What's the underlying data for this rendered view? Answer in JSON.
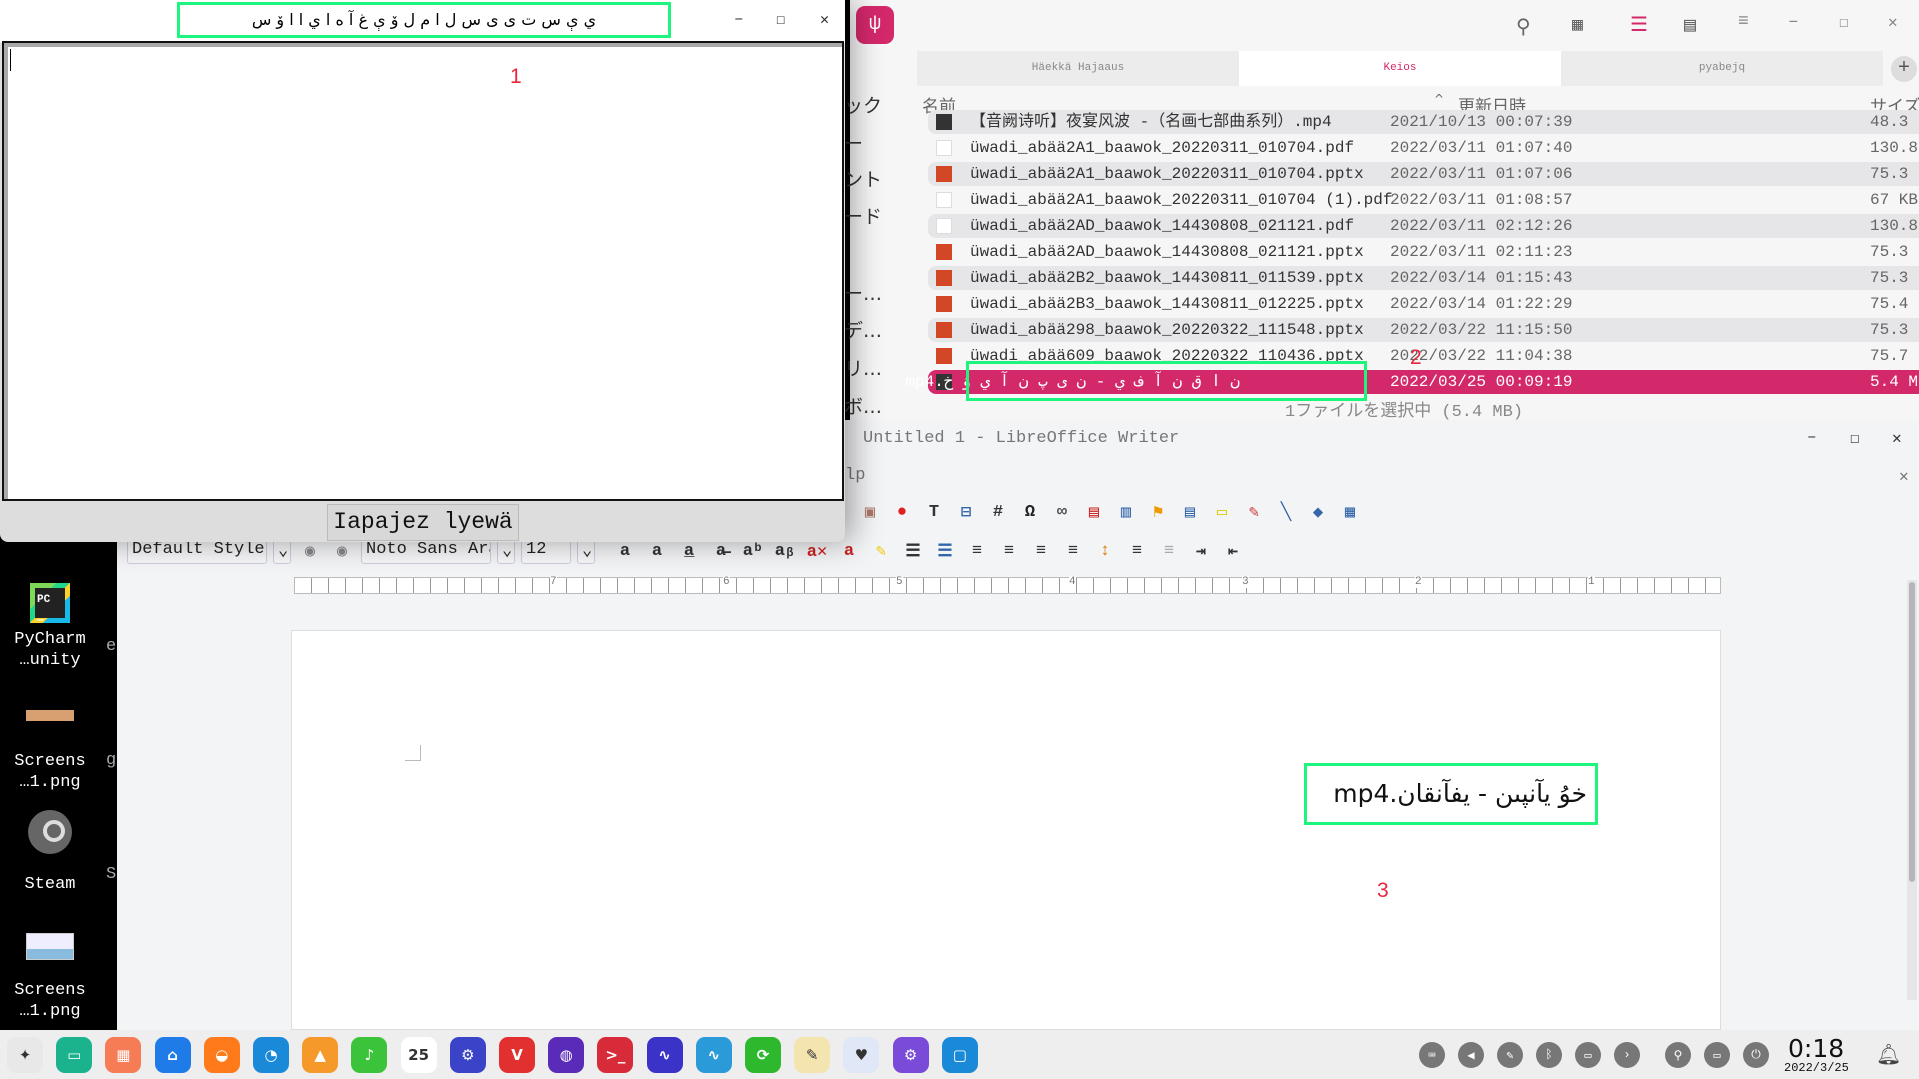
{
  "desktop": {
    "icons": [
      {
        "label1": "PyCharm",
        "label2": "…unity"
      },
      {
        "label1": "Screens",
        "label2": "…1.png"
      },
      {
        "label1": "Steam",
        "label2": ""
      },
      {
        "label1": "Screens",
        "label2": "…1.png"
      }
    ],
    "behind_fragments": [
      "e",
      "g",
      "S"
    ]
  },
  "dialog": {
    "title": "ي ې س ت ى  ى س ل ا م  ل ۆ ې غ آ  ه ا ي ا ا ۆ س",
    "button": "Iapajez lyewä",
    "marker": "1"
  },
  "file_manager": {
    "tabs": [
      "Häekkä Hajaaus",
      "Keios",
      "pyabejq"
    ],
    "columns": {
      "name": "名前",
      "date": "更新日時",
      "size": "サイズ"
    },
    "sidebar": [
      "ック",
      "ー",
      "ント",
      "ード",
      "ー…",
      "デ…",
      "リ…",
      "ボ…"
    ],
    "rows": [
      {
        "name": "【音阙诗听】夜宴风波 -（名画七部曲系列）.mp4",
        "date": "2021/10/13 00:07:39",
        "size": "48.3",
        "type": "video"
      },
      {
        "name": "üwadi_abää2A1_baawok_20220311_010704.pdf",
        "date": "2022/03/11 01:07:40",
        "size": "130.8",
        "type": "pdf"
      },
      {
        "name": "üwadi_abää2A1_baawok_20220311_010704.pptx",
        "date": "2022/03/11 01:07:06",
        "size": "75.3",
        "type": "pptx"
      },
      {
        "name": "üwadi_abää2A1_baawok_20220311_010704 (1).pdf",
        "date": "2022/03/11 01:08:57",
        "size": "67 KB",
        "type": "pdf"
      },
      {
        "name": "üwadi_abää2AD_baawok_14430808_021121.pdf",
        "date": "2022/03/11 02:12:26",
        "size": "130.8",
        "type": "pdf"
      },
      {
        "name": "üwadi_abää2AD_baawok_14430808_021121.pptx",
        "date": "2022/03/11 02:11:23",
        "size": "75.3",
        "type": "pptx"
      },
      {
        "name": "üwadi_abää2B2_baawok_14430811_011539.pptx",
        "date": "2022/03/14 01:15:43",
        "size": "75.3",
        "type": "pptx"
      },
      {
        "name": "üwadi_abää2B3_baawok_14430811_012225.pptx",
        "date": "2022/03/14 01:22:29",
        "size": "75.4",
        "type": "pptx"
      },
      {
        "name": "üwadi_abää298_baawok_20220322_111548.pptx",
        "date": "2022/03/22 11:15:50",
        "size": "75.3",
        "type": "pptx"
      },
      {
        "name": "üwadi_abää609_baawok_20220322_110436.pptx",
        "date": "2022/03/22 11:04:38",
        "size": "75.7",
        "type": "pptx"
      },
      {
        "name": "ن ا ق ن آ ف ي  -  ن ى پ ن آ ي  ۋ خ.mp4",
        "date": "2022/03/25 00:09:19",
        "size": "5.4 M",
        "type": "video",
        "selected": true
      }
    ],
    "status": "1ファイルを選択中 (5.4 MB)",
    "marker": "2",
    "accent": "#d3286a"
  },
  "writer": {
    "title": "Untitled 1 - LibreOffice Writer",
    "menu_fragment": "lp",
    "style": "Default Style",
    "font": "Noto Sans Ara",
    "size": "12",
    "ruler_labels": [
      "7",
      "6",
      "5",
      "4",
      "3",
      "2",
      "1"
    ],
    "text": "خوُ يآنپىن - يفآنقان.mp4",
    "marker": "3"
  },
  "taskbar": {
    "clock": "0:18",
    "date": "2022/3/25",
    "calendar_day": "25"
  }
}
